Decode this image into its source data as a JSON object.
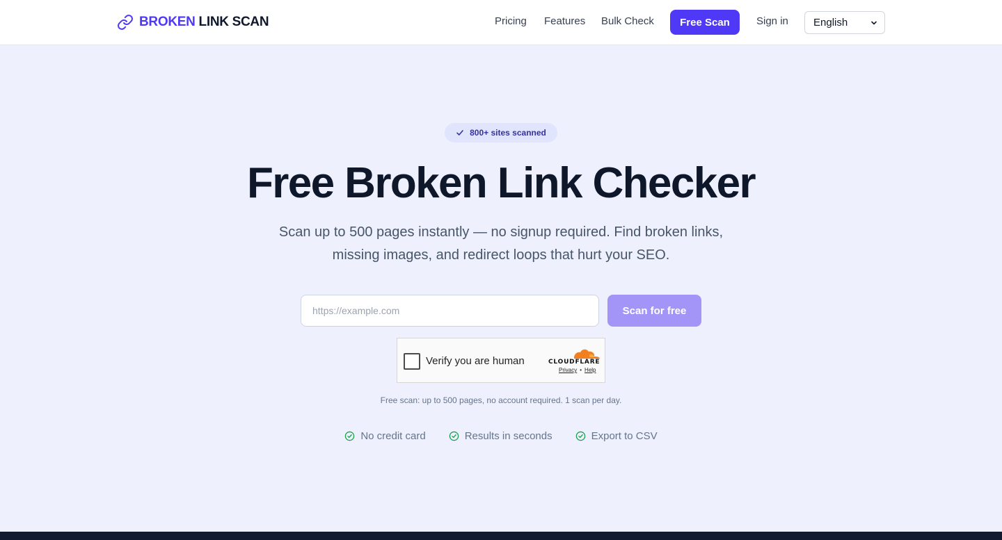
{
  "header": {
    "logo_brand": "BROKEN",
    "logo_rest": "LINK SCAN",
    "nav": {
      "pricing": "Pricing",
      "features": "Features",
      "bulk_check": "Bulk Check",
      "free_scan": "Free Scan",
      "sign_in": "Sign in"
    },
    "language": "English"
  },
  "hero": {
    "badge": "800+ sites scanned",
    "title": "Free Broken Link Checker",
    "subtitle": "Scan up to 500 pages instantly — no signup required. Find broken links, missing images, and redirect loops that hurt your SEO.",
    "url_placeholder": "https://example.com",
    "scan_button": "Scan for free",
    "captcha": {
      "label": "Verify you are human",
      "provider": "CLOUDFLARE",
      "privacy": "Privacy",
      "separator": "•",
      "help": "Help"
    },
    "note": "Free scan: up to 500 pages, no account required. 1 scan per day.",
    "features": [
      "No credit card",
      "Results in seconds",
      "Export to CSV"
    ]
  },
  "colors": {
    "accent": "#4f39f6",
    "accent_disabled": "#a395f8",
    "hero_bg": "#eef1fd",
    "success": "#16a34a"
  },
  "icons": {
    "logo": "link-icon",
    "badge": "check-icon",
    "feature": "check-circle-icon",
    "select": "chevron-down-icon"
  }
}
